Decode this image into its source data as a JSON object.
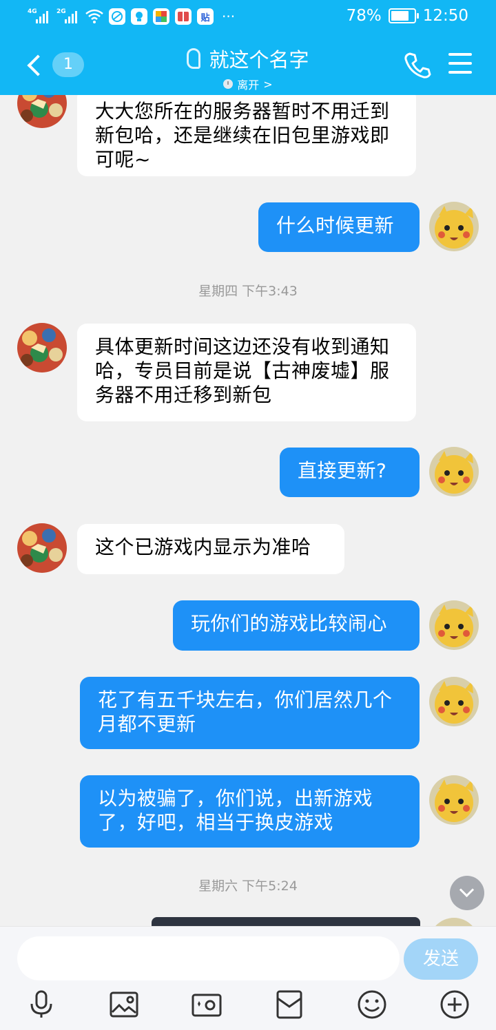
{
  "status_bar": {
    "network1": "4G",
    "network2": "2G",
    "battery_percent": "78%",
    "battery_level": 0.78,
    "time": "12:50",
    "overflow": "···",
    "app_icon_label": "贴"
  },
  "header": {
    "unread_count": "1",
    "title": "就这个名字",
    "status": "离开",
    "status_chevron": ">"
  },
  "messages": [
    {
      "text": "大大您所在的服务器暂时不用迁到新包哈，还是继续在旧包里游戏即可呢~"
    },
    {
      "text": "什么时候更新"
    },
    {
      "text": "星期四 下午3:43"
    },
    {
      "text": "具体更新时间这边还没有收到通知哈，专员目前是说【古神废墟】服务器不用迁移到新包"
    },
    {
      "text": "直接更新?"
    },
    {
      "text": "这个已游戏内显示为准哈"
    },
    {
      "text": "玩你们的游戏比较闹心"
    },
    {
      "text": "花了有五千块左右，你们居然几个月都不更新"
    },
    {
      "text": "以为被骗了，你们说，出新游戏了，好吧，相当于换皮游戏"
    },
    {
      "text": "星期六 下午5:24"
    }
  ],
  "input": {
    "value": "",
    "send_label": "发送"
  },
  "colors": {
    "header_bg": "#12b7f5",
    "outgoing_bubble": "#1e91f7",
    "incoming_bubble": "#ffffff",
    "send_button": "#a3d5f8"
  },
  "icons": [
    "back-arrow-icon",
    "ear-icon",
    "clock-icon",
    "phone-icon",
    "menu-icon",
    "voice-icon",
    "image-icon",
    "camera-icon",
    "red-packet-icon",
    "emoji-icon",
    "plus-icon",
    "scroll-down-icon"
  ]
}
